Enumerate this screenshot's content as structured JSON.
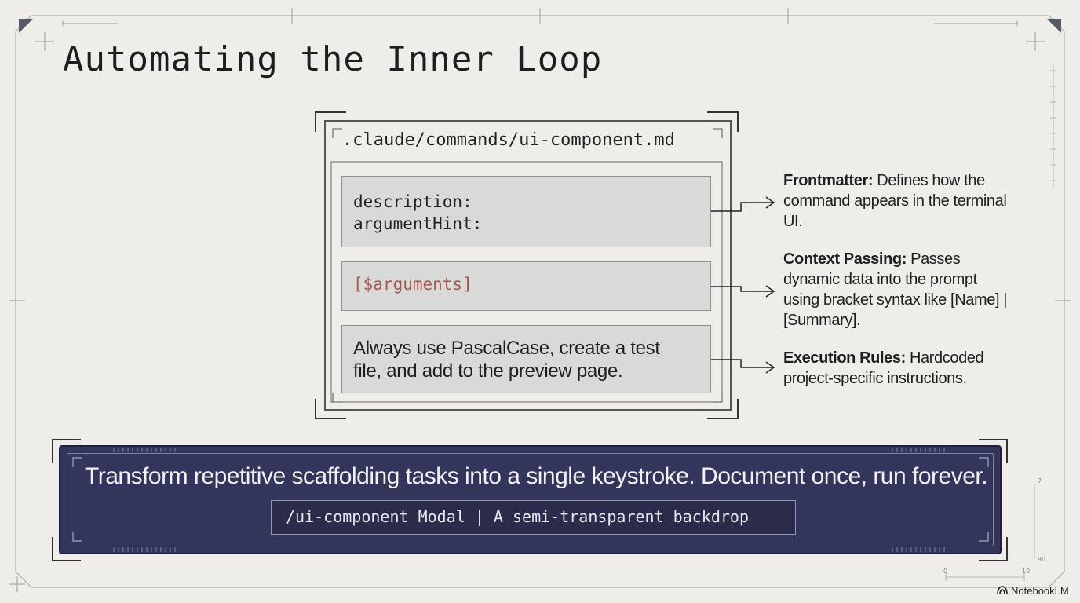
{
  "title": "Automating the Inner Loop",
  "file": {
    "name": ".claude/commands/ui-component.md",
    "frontmatter_lines": [
      "description:",
      "argumentHint:"
    ],
    "arguments_placeholder": "[$arguments]",
    "rules_text_line1": "Always use PascalCase, create a test",
    "rules_text_line2": "file, and add to the preview page."
  },
  "annotations": [
    {
      "label": "Frontmatter:",
      "text": " Defines how the command appears in the terminal UI."
    },
    {
      "label": "Context Passing:",
      "text": " Passes dynamic data into the prompt using bracket syntax like [Name] | [Summary]."
    },
    {
      "label": "Execution Rules:",
      "text": " Hardcoded project-specific instructions."
    }
  ],
  "banner": {
    "text": "Transform repetitive scaffolding tasks into a single keystroke. Document once, run forever.",
    "command": "/ui-component Modal | A semi-transparent backdrop"
  },
  "ruler": {
    "top_label": "7",
    "mid_label": "90",
    "start_label": "0",
    "end_label": "10"
  },
  "brand": "NotebookLM",
  "colors": {
    "background": "#eeede9",
    "block_fill": "#d9d9d8",
    "argument_text": "#a6584e",
    "banner_fill": "#34355a"
  }
}
